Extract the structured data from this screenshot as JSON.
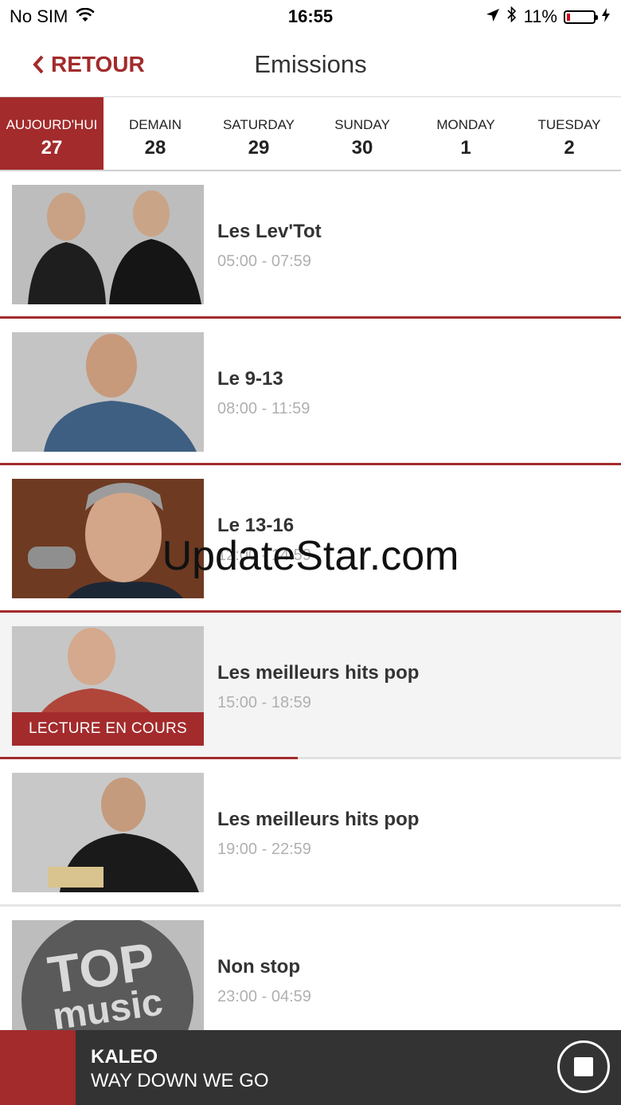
{
  "status": {
    "carrier": "No SIM",
    "time": "16:55",
    "battery": "11%"
  },
  "nav": {
    "back_label": "RETOUR",
    "title": "Emissions"
  },
  "days": [
    {
      "name": "AUJOURD'HUI",
      "num": "27",
      "active": true
    },
    {
      "name": "DEMAIN",
      "num": "28"
    },
    {
      "name": "SATURDAY",
      "num": "29"
    },
    {
      "name": "SUNDAY",
      "num": "30"
    },
    {
      "name": "MONDAY",
      "num": "1"
    },
    {
      "name": "TUESDAY",
      "num": "2"
    }
  ],
  "shows": [
    {
      "title": "Les Lev'Tot",
      "time": "05:00 - 07:59"
    },
    {
      "title": "Le 9-13",
      "time": "08:00 - 11:59"
    },
    {
      "title": "Le 13-16",
      "time": "12:00 - 14:59"
    },
    {
      "title": "Les meilleurs hits pop",
      "time": "15:00 - 18:59",
      "badge": "LECTURE EN COURS",
      "progress": 0.48
    },
    {
      "title": "Les meilleurs hits pop",
      "time": "19:00 - 22:59"
    },
    {
      "title": "Non stop",
      "time": "23:00 - 04:59",
      "logo_line1": "TOP",
      "logo_line2": "music"
    }
  ],
  "watermark": "UpdateStar.com",
  "player": {
    "artist": "KALEO",
    "track": "WAY DOWN WE GO"
  },
  "colors": {
    "accent": "#a32b2c",
    "player_bg": "#333333"
  }
}
